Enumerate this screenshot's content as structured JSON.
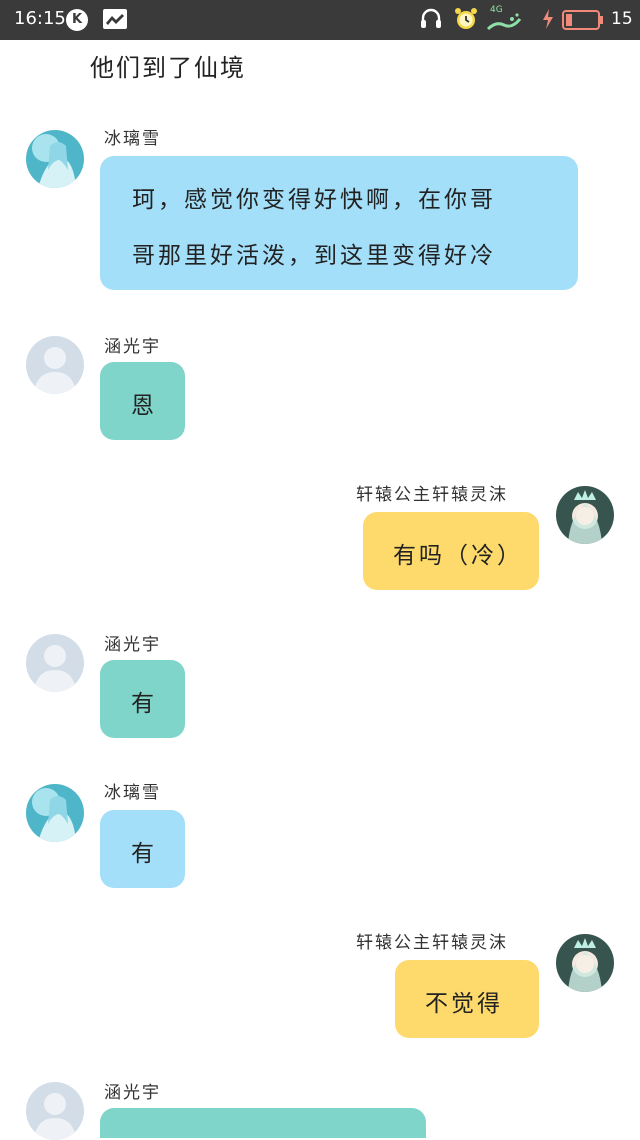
{
  "status_bar": {
    "time": "16:15",
    "k_badge": "K",
    "network": "4G",
    "battery_level": "15",
    "icons": [
      "k-app-icon",
      "news-icon",
      "headphones-icon",
      "alarm-icon",
      "network-signal-icon",
      "charging-bolt-icon",
      "battery-icon"
    ]
  },
  "caption": "他们到了仙境",
  "messages": [
    {
      "sender": "冰璃雪",
      "side": "left",
      "color": "blue",
      "lines": [
        "珂，感觉你变得好快啊，在你哥",
        "哥那里好活泼，到这里变得好冷"
      ]
    },
    {
      "sender": "涵光宇",
      "side": "left",
      "color": "teal",
      "lines": [
        "恩"
      ]
    },
    {
      "sender": "轩辕公主轩辕灵沫",
      "side": "right",
      "color": "yellow",
      "lines": [
        "有吗（冷）"
      ]
    },
    {
      "sender": "涵光宇",
      "side": "left",
      "color": "teal",
      "lines": [
        "有"
      ]
    },
    {
      "sender": "冰璃雪",
      "side": "left",
      "color": "blue",
      "lines": [
        "有"
      ]
    },
    {
      "sender": "轩辕公主轩辕灵沫",
      "side": "right",
      "color": "yellow",
      "lines": [
        "不觉得"
      ]
    },
    {
      "sender": "涵光宇",
      "side": "left",
      "color": "teal",
      "lines": []
    }
  ],
  "colors": {
    "blue_bubble": "#a3dff9",
    "teal_bubble": "#80d5cb",
    "yellow_bubble": "#fdda6b",
    "status_bar": "#3a3a3a"
  }
}
